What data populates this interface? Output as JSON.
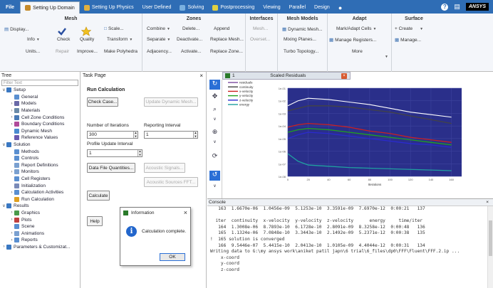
{
  "tabs": [
    {
      "label": "File"
    },
    {
      "label": "Setting Up Domain"
    },
    {
      "label": "Setting Up Physics"
    },
    {
      "label": "User Defined"
    },
    {
      "label": "Solving"
    },
    {
      "label": "Postprocessing"
    },
    {
      "label": "Viewing"
    },
    {
      "label": "Parallel"
    },
    {
      "label": "Design"
    }
  ],
  "brand": "ANSYS",
  "help_label": "?",
  "ribbon": {
    "mesh": {
      "title": "Mesh",
      "display": "Display...",
      "info": "Info",
      "check": "Check",
      "quality": "Quality",
      "scale": "Scale...",
      "transform": "Transform",
      "units": "Units...",
      "repair": "Repair",
      "improve": "Improve...",
      "make_polyhedra": "Make Polyhedra"
    },
    "zones": {
      "title": "Zones",
      "combine": "Combine",
      "delete": "Delete...",
      "separate": "Separate",
      "deactivate": "Deactivate...",
      "adjacency": "Adjacency...",
      "activate": "Activate...",
      "append": "Append",
      "replace_mesh": "Replace Mesh...",
      "replace_zone": "Replace Zone..."
    },
    "interfaces": {
      "title": "Interfaces",
      "mesh": "Mesh...",
      "overset": "Overset..."
    },
    "mesh_models": {
      "title": "Mesh Models",
      "dynamic_mesh": "Dynamic Mesh...",
      "mixing_planes": "Mixing Planes...",
      "turbo_topology": "Turbo Topology..."
    },
    "adapt": {
      "title": "Adapt",
      "mark_adapt": "Mark/Adapt Cells",
      "manage_registers": "Manage Registers...",
      "more": "More"
    },
    "surface": {
      "title": "Surface",
      "create": "+ Create",
      "manage": "Manage..."
    }
  },
  "tree": {
    "header": "Tree",
    "filter_placeholder": "Filter Text",
    "items": [
      {
        "label": "Setup",
        "level": 0,
        "toggle": "v",
        "color": "#3a78c2"
      },
      {
        "label": "General",
        "level": 1,
        "toggle": "",
        "color": "#5a8fd0"
      },
      {
        "label": "Models",
        "level": 1,
        "toggle": ">",
        "color": "#6a6aa8"
      },
      {
        "label": "Materials",
        "level": 1,
        "toggle": ">",
        "color": "#6a8aa8"
      },
      {
        "label": "Cell Zone Conditions",
        "level": 1,
        "toggle": ">",
        "color": "#4a7ab5"
      },
      {
        "label": "Boundary Conditions",
        "level": 1,
        "toggle": ">",
        "color": "#b04a9a"
      },
      {
        "label": "Dynamic Mesh",
        "level": 1,
        "toggle": "",
        "color": "#4a8ad0"
      },
      {
        "label": "Reference Values",
        "level": 1,
        "toggle": "",
        "color": "#6a5ab0"
      },
      {
        "label": "Solution",
        "level": 0,
        "toggle": "v",
        "color": "#3a78c2"
      },
      {
        "label": "Methods",
        "level": 1,
        "toggle": "",
        "color": "#5a8fd0"
      },
      {
        "label": "Controls",
        "level": 1,
        "toggle": "",
        "color": "#5a8fd0"
      },
      {
        "label": "Report Definitions",
        "level": 1,
        "toggle": "",
        "color": "#7aa0d0"
      },
      {
        "label": "Monitors",
        "level": 1,
        "toggle": ">",
        "color": "#7aa0d0"
      },
      {
        "label": "Cell Registers",
        "level": 1,
        "toggle": "",
        "color": "#5a8fd0"
      },
      {
        "label": "Initialization",
        "level": 1,
        "toggle": "",
        "color": "#7a8ab8"
      },
      {
        "label": "Calculation Activities",
        "level": 1,
        "toggle": ">",
        "color": "#5a8fd0"
      },
      {
        "label": "Run Calculation",
        "level": 1,
        "toggle": "",
        "color": "#e0a020"
      },
      {
        "label": "Results",
        "level": 0,
        "toggle": "v",
        "color": "#3a78c2"
      },
      {
        "label": "Graphics",
        "level": 1,
        "toggle": ">",
        "color": "#4a9a4a"
      },
      {
        "label": "Plots",
        "level": 1,
        "toggle": ">",
        "color": "#c04040"
      },
      {
        "label": "Scene",
        "level": 1,
        "toggle": "",
        "color": "#5a8fd0"
      },
      {
        "label": "Animations",
        "level": 1,
        "toggle": ">",
        "color": "#7aa0d0"
      },
      {
        "label": "Reports",
        "level": 1,
        "toggle": ">",
        "color": "#5a8fd0"
      },
      {
        "label": "Parameters & Customizat...",
        "level": 0,
        "toggle": ">",
        "color": "#3a78c2"
      }
    ]
  },
  "taskpage": {
    "header": "Task Page",
    "title": "Run Calculation",
    "check_case": "Check Case...",
    "update_dynamic_mesh": "Update Dynamic Mesh...",
    "num_iterations_label": "Number of Iterations",
    "num_iterations": "300",
    "reporting_interval_label": "Reporting Interval",
    "reporting_interval": "1",
    "profile_update_label": "Profile Update Interval",
    "profile_update": "1",
    "data_file_quantities": "Data File Quantities...",
    "acoustic_signals": "Acoustic Signals...",
    "acoustic_sources_fft": "Acoustic Sources FFT...",
    "calculate": "Calculate",
    "help": "Help"
  },
  "dialog": {
    "title": "Information",
    "message": "Calculation complete.",
    "ok": "OK"
  },
  "graphics": {
    "tab_title": "Scaled Residuals",
    "tab_number": "1"
  },
  "chart_data": {
    "type": "line",
    "title": "",
    "xlabel": "Iterations",
    "ylabel": "",
    "ylim": [
      0,
      7
    ],
    "xlim": [
      0,
      170
    ],
    "legend_position": "top-left",
    "series": [
      {
        "name": "residuals",
        "color": "#7a4aa0",
        "x": [],
        "y": []
      },
      {
        "name": "continuity",
        "color": "#444444",
        "x": [
          0,
          10,
          20,
          40,
          60,
          80,
          100,
          120,
          140,
          160
        ],
        "y": [
          5.2,
          5.4,
          5.6,
          5.6,
          5.5,
          5.3,
          5.1,
          4.8,
          4.5,
          4.2
        ]
      },
      {
        "name": "x-velocity",
        "color": "#cc2020",
        "x": [
          0,
          10,
          20,
          40,
          60,
          80,
          100,
          120,
          140,
          160
        ],
        "y": [
          3.9,
          4.1,
          4.2,
          4.1,
          3.9,
          3.6,
          3.4,
          3.1,
          2.9,
          2.7
        ]
      },
      {
        "name": "y-velocity",
        "color": "#20a020",
        "x": [
          0,
          10,
          20,
          40,
          60,
          80,
          100,
          120,
          140,
          160
        ],
        "y": [
          3.5,
          3.7,
          3.8,
          3.7,
          3.5,
          3.3,
          3.1,
          2.9,
          2.7,
          2.5
        ]
      },
      {
        "name": "z-velocity",
        "color": "#2a2ad0",
        "x": [
          0,
          10,
          20,
          40,
          60,
          80,
          100,
          120,
          140,
          160
        ],
        "y": [
          3.0,
          3.3,
          3.5,
          3.4,
          3.2,
          3.0,
          2.8,
          2.6,
          2.5,
          2.3
        ]
      },
      {
        "name": "energy",
        "color": "#20a0a0",
        "x": [
          0,
          10,
          20,
          40,
          60,
          80,
          100,
          120,
          140,
          160
        ],
        "y": [
          1.8,
          1.2,
          0.9,
          0.8,
          0.7,
          0.65,
          0.6,
          0.55,
          0.5,
          0.45
        ]
      }
    ],
    "white_curve": {
      "x": [
        0,
        10,
        20,
        40,
        60,
        80,
        100,
        120,
        140,
        160
      ],
      "y": [
        5.6,
        6.0,
        6.2,
        6.1,
        5.9,
        5.7,
        5.4,
        5.1,
        4.9,
        4.7
      ]
    }
  },
  "console": {
    "header": "Console",
    "lines": [
      "   163  1.6670e-06  1.0456e-09  5.1253e-10  3.3591e-09  7.6970e-12  0:00:21   137",
      "",
      "  iter  continuity  x-velocity  y-velocity  z-velocity      energy     time/iter",
      "   164  1.3008e-06  8.7893e-10  6.1728e-10  2.8091e-09  8.3258e-12  0:00:48   136",
      "   165  1.1324e-06  7.0848e-10  3.3443e-10  2.1492e-09  5.2371e-12  0:00:38   135",
      "!  165 solution is converged",
      "   166  9.5446e-07  5.4415e-10  2.0413e-10  1.0105e-09  4.4044e-12  0:00:31   134",
      "Writing data to G:\\my ansys work\\aniket patil japn\\6 trial\\6_files\\dp0\\FFF\\Fluent\\FFF.2.ip ...",
      "    x-coord",
      "    y-coord",
      "    z-coord"
    ]
  }
}
